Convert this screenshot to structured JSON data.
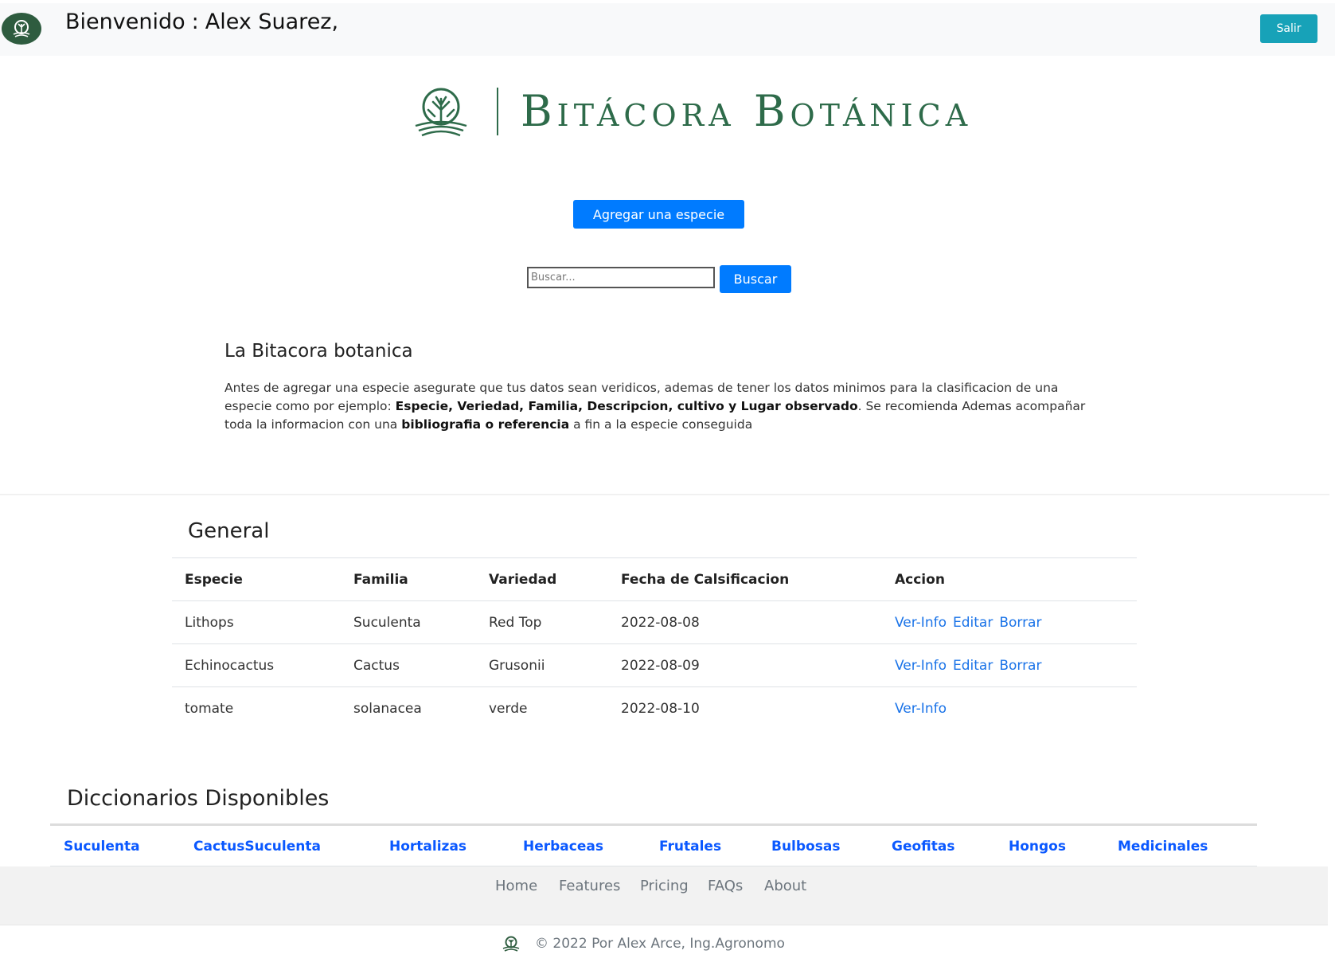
{
  "header": {
    "welcome_label": "Bienvenido",
    "separator": ":",
    "user_name": "Alex Suarez,",
    "logout_label": "Salir"
  },
  "brand": {
    "name": "Bitácora Botánica",
    "colors": {
      "primary_green": "#2e6b4a"
    }
  },
  "actions": {
    "add_species_label": "Agregar una especie",
    "search_placeholder": "Buscar...",
    "search_button_label": "Buscar"
  },
  "intro": {
    "title": "La Bitacora botanica",
    "p1": "Antes de agregar una especie asegurate que tus datos sean veridicos, ademas de tener los datos minimos para la clasificacion de una especie como por ejemplo: ",
    "p1_bold": "Especie, Veriedad, Familia, Descripcion, cultivo y Lugar observado",
    "p2": ". Se recomienda Ademas acompañar toda la informacion con una ",
    "p2_bold": "bibliografia o referencia",
    "p3": " a fin a la especie conseguida"
  },
  "general": {
    "title": "General",
    "columns": [
      "Especie",
      "Familia",
      "Variedad",
      "Fecha de Calsificacion",
      "Accion"
    ],
    "rows": [
      {
        "especie": "Lithops",
        "familia": "Suculenta",
        "variedad": "Red Top",
        "fecha": "2022-08-08",
        "actions": [
          "Ver-Info",
          "Editar",
          "Borrar"
        ]
      },
      {
        "especie": "Echinocactus",
        "familia": "Cactus",
        "variedad": "Grusonii",
        "fecha": "2022-08-09",
        "actions": [
          "Ver-Info",
          "Editar",
          "Borrar"
        ]
      },
      {
        "especie": "tomate",
        "familia": "solanacea",
        "variedad": "verde",
        "fecha": "2022-08-10",
        "actions": [
          "Ver-Info"
        ]
      }
    ]
  },
  "dictionaries": {
    "title": "Diccionarios Disponibles",
    "items": [
      "Suculenta",
      "CactusSuculenta",
      "Hortalizas",
      "Herbaceas",
      "Frutales",
      "Bulbosas",
      "Geofitas",
      "Hongos",
      "Medicinales"
    ]
  },
  "footer": {
    "nav": [
      "Home",
      "Features",
      "Pricing",
      "FAQs",
      "About"
    ],
    "copyright": "© 2022 Por Alex Arce, Ing.Agronomo"
  },
  "colors": {
    "primary_button": "#007bff",
    "logout_button": "#17a2b8",
    "link": "#1a73e8"
  }
}
